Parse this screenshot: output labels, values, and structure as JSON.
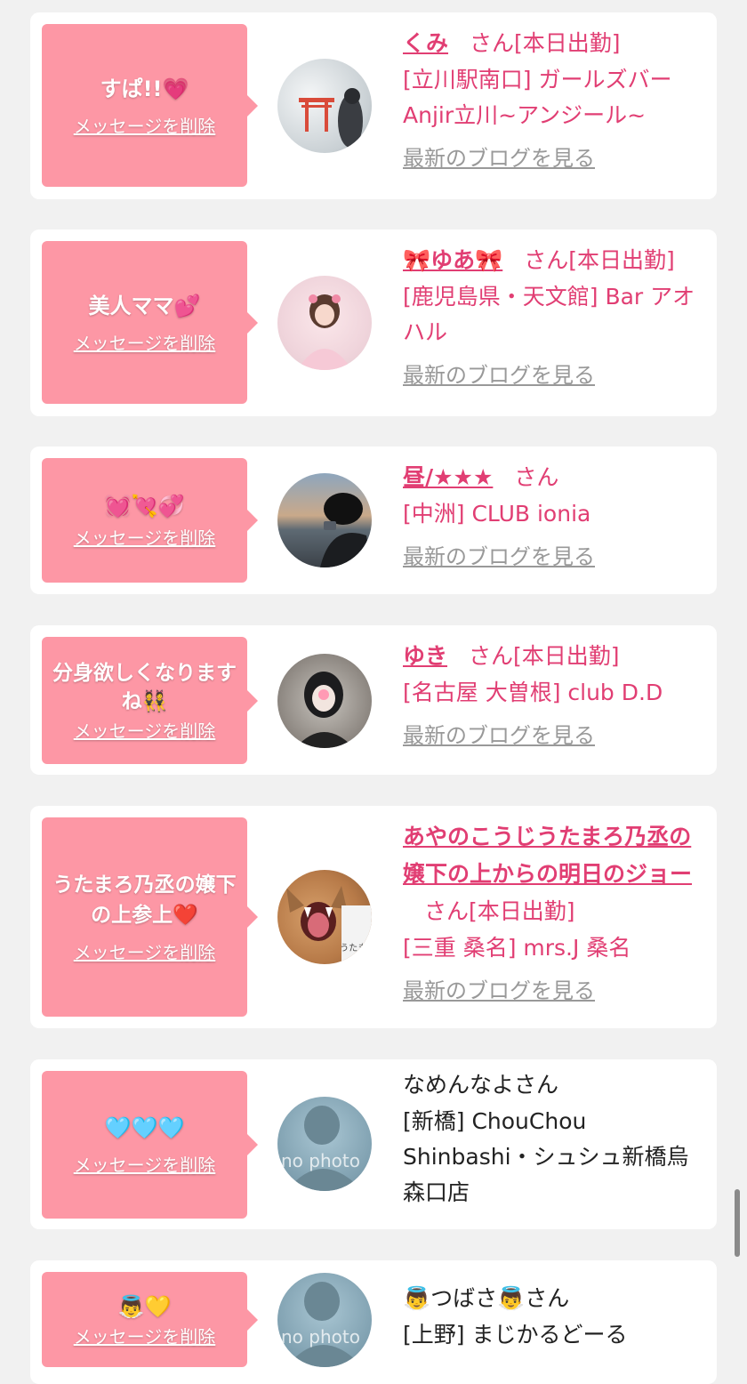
{
  "accent": "#e13e73",
  "bubble_color": "#fd97a5",
  "delete_label": "メッセージを削除",
  "blog_label": "最新のブログを見る",
  "san": "さん",
  "working_today": "[本日出勤]",
  "cards": [
    {
      "message": "すぱ!!💗",
      "name": "くみ",
      "shop": "[立川駅南口] ガールズバーAnjir立川~アンジール~"
    },
    {
      "message": "美人ママ💕",
      "name": "🎀ゆあ🎀",
      "shop": "[鹿児島県・天文館] Bar アオハル"
    },
    {
      "message": "💓💘💞",
      "name": "昼/★★★",
      "shop": "[中洲] CLUB ionia"
    },
    {
      "message": "分身欲しくなりますね👯",
      "name": "ゆき",
      "shop": "[名古屋 大曽根] club D.D"
    },
    {
      "message": "うたまろ乃丞の嬢下の上参上❤️",
      "name": "あやのこうじうたまろ乃丞の嬢下の上からの明日のジョー",
      "shop": "[三重 桑名] mrs.J 桑名",
      "avatar_note": "うたま"
    },
    {
      "message": "🩵🩵🩵",
      "name": "なめんなよ",
      "shop": "[新橋] ChouChou Shinbashi・シュシュ新橋烏森口店",
      "photo_placeholder": "no photo"
    },
    {
      "message": "👼💛",
      "name": "👼つばさ👼",
      "shop": "[上野] まじかるどーる",
      "photo_placeholder": "no photo"
    }
  ]
}
